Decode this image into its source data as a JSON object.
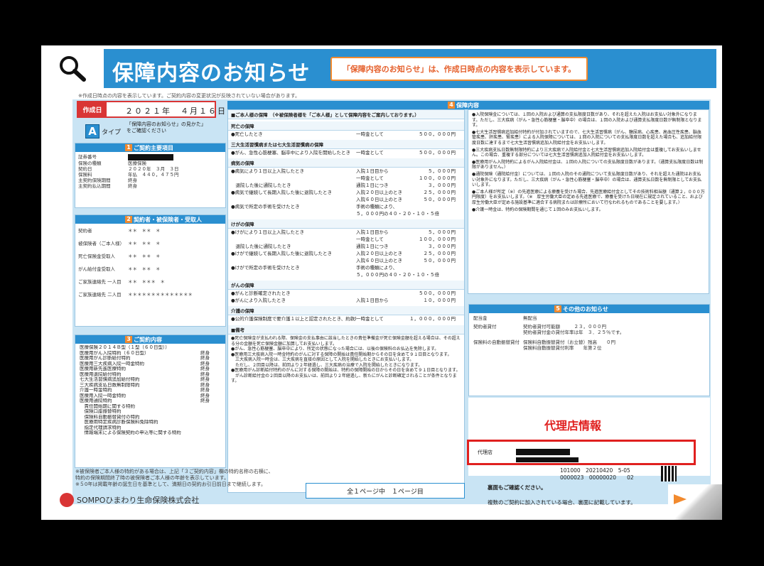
{
  "header": {
    "title": "保障内容のお知らせ",
    "notice": "「保障内容のお知らせ」は、作成日時点の内容を表示しています。"
  },
  "top_note": "※作成日時点の内容を表示しています。ご契約内容の変更状況が反映されていない場合があります。",
  "created": {
    "label": "作成日",
    "value": "２０２１年　４月１６日"
  },
  "type": {
    "letter": "A",
    "label": "タイプ",
    "note1": "「保障内容のお知らせ」の見かた」",
    "note2": "をご確認ください"
  },
  "section1": {
    "num": "1",
    "title": "ご契約主要項目",
    "rows": [
      {
        "k": "証券番号",
        "v": ""
      },
      {
        "k": "保険の種類",
        "v": "医療保険"
      },
      {
        "k": "契約日",
        "v": "２０２０年　３月　３日"
      },
      {
        "k": "保険料",
        "v": "年払　４４０，４７５円"
      },
      {
        "k": "主契約保険期間",
        "v": "終身"
      },
      {
        "k": "主契約払込期間",
        "v": "終身"
      }
    ]
  },
  "section2": {
    "num": "2",
    "title": "契約者・被保険者・受取人",
    "rows": [
      {
        "k": "契約者",
        "v": "＊＊　＊＊　＊"
      },
      {
        "k": "被保険者（ご本人様）",
        "v": "＊＊　＊＊　＊"
      },
      {
        "k": "死亡保険金受取人",
        "v": "＊＊　＊＊　＊"
      },
      {
        "k": "がん給付金受取人",
        "v": "＊＊　＊＊　＊"
      },
      {
        "k": "ご家族連絡先 一人目",
        "v": "＊＊　＊＊＊　＊"
      },
      {
        "k": "ご家族連絡先 二人目",
        "v": "＊＊＊＊＊＊＊＊＊＊＊＊＊＊"
      }
    ]
  },
  "section3": {
    "num": "3",
    "title": "ご契約内容",
    "items": [
      {
        "name": "医療保険２０１４Ｂ型（１型（６０日型））",
        "term": ""
      },
      {
        "name": "医療用がん入院特約（６０日型）",
        "term": "終身"
      },
      {
        "name": "医療用がん診断給付特約",
        "term": "終身"
      },
      {
        "name": "医療用三大疾病入院一時金特約",
        "term": "終身"
      },
      {
        "name": "医療用新先進医療特約",
        "term": "終身"
      },
      {
        "name": "医療用退院給付特約",
        "term": "終身"
      },
      {
        "name": "七大生活習慣病追加給付特約",
        "term": "終身"
      },
      {
        "name": "三大疾病支払日数無制限特約",
        "term": "終身"
      },
      {
        "name": "介護一時金特約",
        "term": "終身"
      },
      {
        "name": "医療用入院一時金特約",
        "term": "終身"
      },
      {
        "name": "医療用通院特約",
        "term": "終身"
      },
      {
        "name": "　責任開始期に関する特約",
        "term": ""
      },
      {
        "name": "　保険口座振替特約",
        "term": ""
      },
      {
        "name": "　保険料自動振替貸付の特約",
        "term": ""
      },
      {
        "name": "　医療用特定疾病診断保険料免除特約",
        "term": ""
      },
      {
        "name": "　指定代理請求特約",
        "term": ""
      },
      {
        "name": "　情報端末による保険契約の申込等に関する特約",
        "term": ""
      }
    ]
  },
  "section4": {
    "num": "4",
    "title": "保障内容",
    "intro": "■ご本人様の保障　（※被保険者様を「ご本人様」として保障内容をご案内しております。）",
    "groups": [
      {
        "title": "死亡の保障",
        "rows": [
          {
            "c1": "●死亡したとき",
            "c2": "一時金として",
            "c3": "５００，０００円"
          }
        ]
      },
      {
        "title": "三大生活習慣病または七大生活習慣病の保障",
        "rows": [
          {
            "c1": "●がん、急性心筋梗塞、脳卒中により入院を開始したとき",
            "c2": "一時金として",
            "c3": "５００，０００円"
          }
        ]
      },
      {
        "title": "病気の保障",
        "rows": [
          {
            "c1": "●病気により１日以上入院したとき",
            "c2": "入院１日目から",
            "c3": "５，０００円"
          },
          {
            "c1": "",
            "c2": "一時金として",
            "c3": "１００，０００円"
          },
          {
            "c1": "　退院した後に通院したとき",
            "c2": "通院１日につき",
            "c3": "３，０００円"
          },
          {
            "c1": "●病気で継続して長期入院した後に退院したとき",
            "c2": "入院２０日以上のとき",
            "c3": "２５，０００円"
          },
          {
            "c1": "",
            "c2": "入院６０日以上のとき",
            "c3": "５０，０００円"
          },
          {
            "c1": "●病気で所定の手術を受けたとき",
            "c2": "手術の種類により、",
            "c3": ""
          },
          {
            "c1": "",
            "c2": "５，０００円の４０・２０・１０・５倍",
            "c3": ""
          }
        ]
      },
      {
        "title": "けがの保障",
        "rows": [
          {
            "c1": "●けがにより１日以上入院したとき",
            "c2": "入院１日目から",
            "c3": "５，０００円"
          },
          {
            "c1": "",
            "c2": "一時金として",
            "c3": "１００，０００円"
          },
          {
            "c1": "　退院した後に通院したとき",
            "c2": "通院１日につき",
            "c3": "３，０００円"
          },
          {
            "c1": "●けがで継続して長期入院した後に退院したとき",
            "c2": "入院２０日以上のとき",
            "c3": "２５，０００円"
          },
          {
            "c1": "",
            "c2": "入院６０日以上のとき",
            "c3": "５０，０００円"
          },
          {
            "c1": "●けがで所定の手術を受けたとき",
            "c2": "手術の種類により、",
            "c3": ""
          },
          {
            "c1": "",
            "c2": "５，０００円の４０・２０・１０・５倍",
            "c3": ""
          }
        ]
      },
      {
        "title": "がんの保障",
        "rows": [
          {
            "c1": "●がんと診断確定されたとき",
            "c2": "",
            "c3": "５００，０００円"
          },
          {
            "c1": "●がんにより入院したとき",
            "c2": "入院１日目から",
            "c3": "１０，０００円"
          }
        ]
      },
      {
        "title": "介護の保障",
        "rows": [
          {
            "c1": "●公的介護保険制度で要介護１以上と認定されたとき、約款所定の要介護状態になったとき、または高度障害状態に該当したとき",
            "c2": "一時金として",
            "c3": "１，０００，０００円"
          }
        ]
      }
    ],
    "remarks_title": "■備考",
    "remarks": [
      "●死亡保険金が支払われる際、保険金の支払事由に該当したときの責任準備金が死亡保険金額を超える場合は、その超える分の金額を死亡保険金額に加算してお支払いします。",
      "●がん、急性心筋梗塞、脳卒中により、所定の状態になった場合には、以後の保険料のお払込を免除します。",
      "●医療用三大疾病入院一時金特約のがんに対する保障の開始は責任開始期からその日を含めて９１日目となります。",
      "　三大疾病入院一時金は、三大疾病を直接の原因として入院を開始したときにお支払いします。",
      "　ただし、２回目以降は、前回より２年経過し、三大疾病の治療で入院を開始したときになります。",
      "●医療用がん診断給付特約のがんに対する保障の開始は、特約の保障開始の日からその日を含めて９１日目となります。",
      "　がん診断給付金の２回目以降のお支払いは、前回より２年経過し、新たにがんと診断確定されることが条件となります。"
    ],
    "right_notes": [
      "●入院保険金については、１回の入院および通算の支払限度日数があり、それを超えた入院はお支払い対象外になります。ただし、三大疾病（がん・急性心筋梗塞・脳卒中）の場合は、１回の入院および通算支払限度日数が無制限となります。",
      "●七大生活習慣病追加給付特約が付加されていますので、七大生活習慣病（がん、糖尿病、心疾患、高血圧性疾患、脳血管疾患、肝疾患、腎疾患）による入院保障については、１回の入院についての支払限度日数を超えた場合も、追加給付限度日数に達するまで七大生活習慣病追加入院給付金をお支払いします。",
      "●三大疾病支払日数無制限特約により三大疾病で入院給付金と七大生活習慣病追加入院給付金は重複してお支払いしません。この場合、重複する部分については七大生活習慣病追加入院給付金をお支払いします。",
      "●医療用がん入院特約によるがん入院給付金は、１回の入院についての支払限度日数があります。（通算支払限度日数は制限がありません。）",
      "●通院保険（通院給付金）については、１回の入院のその通院について支払限度日数があり、それを超えた通院はお支払い対象外になります。ただし、三大疾病（がん・急性心筋梗塞・脳卒中）の場合は、通算支払日数を無制限としてお支払いします。",
      "●ご本人様が所定（※）の先進医療による療養を受けた場合、先進医療給付金としてその技術料相当額（通算２，０００万円限度）をお支払いします。（※　厚生労働大臣の定める先進医療で、療養を受けた日現在に規定されていること、および厚生労働大臣が定める施設基準に適合する病院または診療所において行なわれるものであることを要します。）",
      "●介護一時金は、特約の保険期間を通じて１回のみお支払いします。"
    ]
  },
  "section5": {
    "num": "5",
    "title": "その他のお知らせ",
    "rows": [
      {
        "k": "配当金",
        "v": "無配当"
      },
      {
        "k": "契約者貸付",
        "v": "契約者貸付可能額　　　２３，０００円"
      },
      {
        "k": "",
        "v": "契約者貸付金の貸付年率は年　３．２５％です。"
      },
      {
        "k": "保険料の自動振替貸付",
        "v": "保険料自動振替貸付（お立替）残高　　０円"
      },
      {
        "k": "",
        "v": "保険料自動振替貸付利率　　年第２位"
      }
    ]
  },
  "agent": {
    "annotation": "代理店情報",
    "label": "代理店"
  },
  "codes": {
    "line1": "101000　20210420　5-05",
    "line2": "0000023　00000020　　02"
  },
  "footer": {
    "note1": "※被保険者ご本人様の特約がある場合は、上記「３ご契約内容」欄の特約名称の右横に、",
    "note2": "特約の保険期間終了時の被保険者ご本人様の年齢を表示しています。",
    "note3": "※５0年は掲載年齢の誕生日を基準として、満期日の契約お引日前日まで継続します。",
    "page_count": "全１ページ中　１ページ目",
    "company": "SOMPOひまわり生命保険株式会社",
    "back_check": "裏面もご確認ください。",
    "back_note": "複数のご契約に加入されている場合、裏面に記載しています。"
  }
}
